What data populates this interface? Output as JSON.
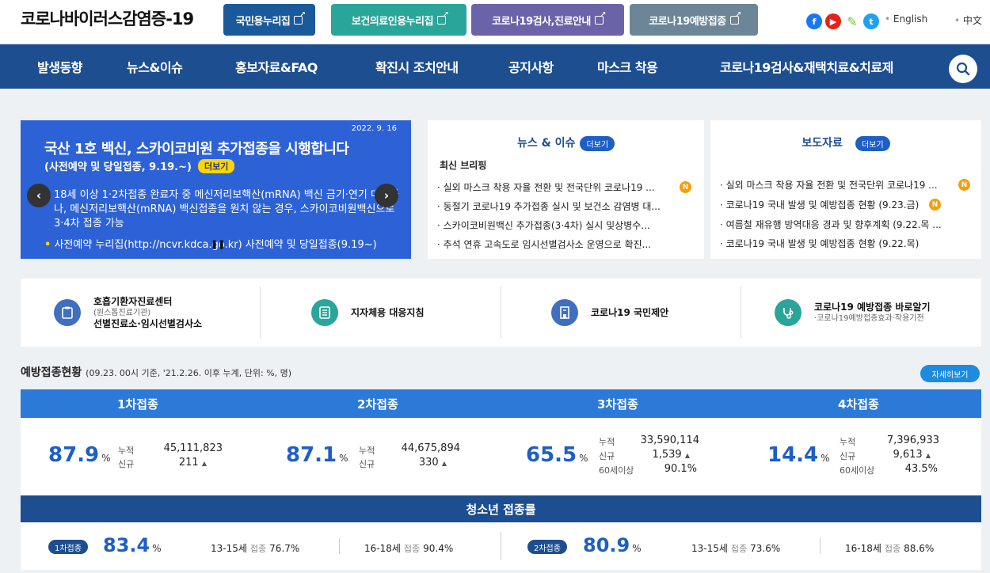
{
  "header": {
    "site_title": "코로나바이러스감염증-19",
    "top_buttons": [
      {
        "label": "국민용누리집",
        "color": "#1a5a9a"
      },
      {
        "label": "보건의료인용누리집",
        "color": "#2aa59a"
      },
      {
        "label": "코로나19검사,진료안내",
        "color": "#6a63a8"
      },
      {
        "label": "코로나19예방접종",
        "color": "#6c8698"
      }
    ],
    "sns": [
      "facebook-icon",
      "youtube-icon",
      "kakao-icon",
      "twitter-icon"
    ],
    "lang": [
      "English",
      "中文"
    ]
  },
  "gnb": {
    "items": [
      "발생동향",
      "뉴스&이슈",
      "홍보자료&FAQ",
      "확진시 조치안내",
      "공지사항",
      "마스크 착용",
      "코로나19검사&재택치료&치료제"
    ]
  },
  "banner": {
    "date": "2022. 9. 16",
    "headline": "국산 1호 백신, 스카이코비원 추가접종을 시행합니다",
    "subhead": "(사전예약 및 당일접종, 9.19.~)",
    "more": "더보기",
    "body": "18세 이상 1·2차접종 완료자 중 메신저리보핵산(mRNA) 백신 금기·연기 대상자나, 메신저리보핵산(mRNA) 백신접종을 원치 않는 경우, 스카이코비원백신으로 3·4차 접종 가능",
    "note_bullet": "•",
    "note": "사전예약 누리집(http://ncvr.kdca.go.kr) 사전예약 및 당일접종(9.19~)"
  },
  "news": {
    "title": "뉴스 & 이슈",
    "more": "더보기",
    "subtitle": "최신 브리핑",
    "items": [
      "· 실외 마스크 착용 자율 전환 및 전국단위 코로나19 ...",
      "· 동절기 코로나19 추가접종 실시 및 보건소 감염병 대...",
      "· 스카이코비원백신 추가접종(3·4차) 실시 및상병수...",
      "· 추석 연휴 고속도로 임시선별검사소 운영으로 확진..."
    ],
    "new_badge": "N"
  },
  "press": {
    "title": "보도자료",
    "more": "더보기",
    "items": [
      "· 실외 마스크 착용 자율 전환 및 전국단위 코로나19 ...",
      "· 코로나19 국내 발생 및 예방접종 현황 (9.23.금)",
      "· 여름철 재유행 방역대응 경과 및 향후계획 (9.22.목 ...",
      "· 코로나19 국내 발생 및 예방접종 현황 (9.22.목)"
    ],
    "new_badge": "N"
  },
  "quick": [
    {
      "title": "호흡기환자진료센터",
      "sub": "(원스톱진료기관)",
      "title2": "선별진료소·임시선별검사소",
      "icon": "clipboard-icon",
      "color": "#3f6fbf"
    },
    {
      "title": "지자체용 대응지침",
      "icon": "document-icon",
      "color": "#2aa59a"
    },
    {
      "title": "코로나19 국민제안",
      "icon": "building-icon",
      "color": "#3f6fbf"
    },
    {
      "title": "코로나19 예방접종 바로알기",
      "sub": "·코로나19예방접종효과·작용기전",
      "icon": "stethoscope-icon",
      "color": "#2aa59a"
    }
  ],
  "vaccination": {
    "title": "예방접종현황",
    "note": "(09.23. 00시 기준, '21.2.26. 이후 누계, 단위: %, 명)",
    "detail_button": "자세히보기",
    "doses": [
      {
        "label": "1차접종",
        "pct": "87.9",
        "unit": "%",
        "cum_label": "누적",
        "cum": "45,111,823",
        "new_label": "신규",
        "new": "211"
      },
      {
        "label": "2차접종",
        "pct": "87.1",
        "unit": "%",
        "cum_label": "누적",
        "cum": "44,675,894",
        "new_label": "신규",
        "new": "330"
      },
      {
        "label": "3차접종",
        "pct": "65.5",
        "unit": "%",
        "cum_label": "누적",
        "cum": "33,590,114",
        "new_label": "신규",
        "new": "1,539",
        "sixty_label": "60세이상",
        "sixty": "90.1%"
      },
      {
        "label": "4차접종",
        "pct": "14.4",
        "unit": "%",
        "cum_label": "누적",
        "cum": "7,396,933",
        "new_label": "신규",
        "new": "9,613",
        "sixty_label": "60세이상",
        "sixty": "43.5%"
      }
    ],
    "up": "▲"
  },
  "youth": {
    "title": "청소년 접종률",
    "first": {
      "tag": "1차접종",
      "pct": "83.4",
      "unit": "%",
      "a_label": "13-15세",
      "a_word": "접종",
      "a_val": "76.7%",
      "b_label": "16-18세",
      "b_word": "접종",
      "b_val": "90.4%"
    },
    "second": {
      "tag": "2차접종",
      "pct": "80.9",
      "unit": "%",
      "a_label": "13-15세",
      "a_word": "접종",
      "a_val": "73.6%",
      "b_label": "16-18세",
      "b_word": "접종",
      "b_val": "88.6%"
    }
  }
}
